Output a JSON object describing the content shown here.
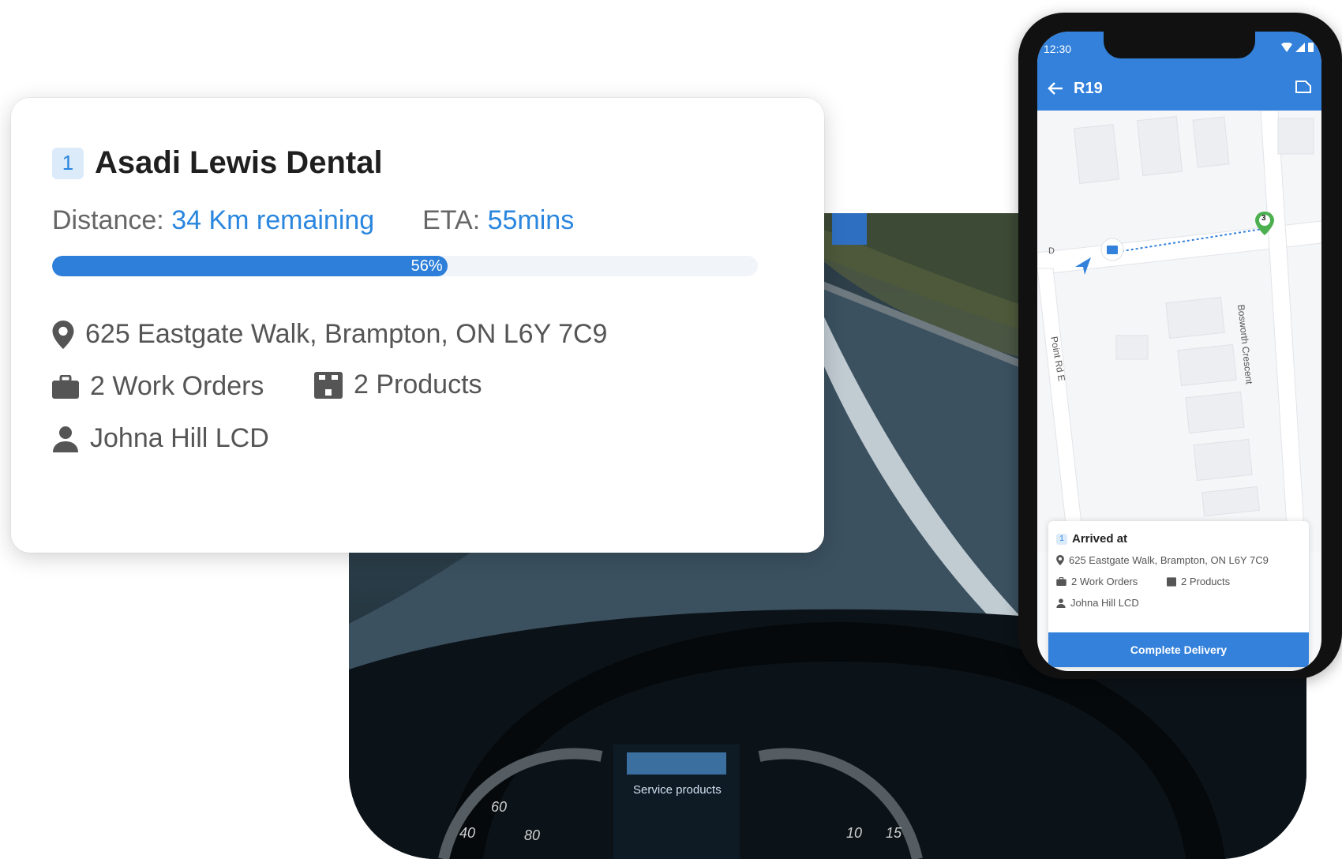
{
  "card": {
    "stop_number": "1",
    "title": "Asadi Lewis Dental",
    "distance_label": "Distance:",
    "distance_value": "34 Km remaining",
    "eta_label": "ETA:",
    "eta_value": "55mins",
    "progress_percent": 56,
    "progress_label": "56%",
    "address": "625 Eastgate Walk, Brampton, ON L6Y 7C9",
    "work_orders": "2 Work Orders",
    "products": "2 Products",
    "contact": "Johna Hill LCD"
  },
  "phone": {
    "status_time": "12:30",
    "route_title": "R19",
    "map": {
      "street_top": "D",
      "street_right": "Bosworth Crescent",
      "street_left": "Point Rd E",
      "marker_number": "3"
    },
    "sheet": {
      "stop_number": "1",
      "arrived_label": "Arrived at",
      "address": "625 Eastgate Walk, Brampton, ON L6Y 7C9",
      "work_orders": "2 Work Orders",
      "products": "2 Products",
      "contact": "Johna Hill LCD",
      "cta_label": "Complete Delivery"
    }
  },
  "dashboard": {
    "display_text": "Service products",
    "speedo_left": [
      "40",
      "60",
      "80"
    ],
    "speedo_right": [
      "10",
      "15"
    ]
  },
  "colors": {
    "accent": "#2a86de",
    "appbar": "#3381db",
    "marker_green": "#4caf50"
  }
}
